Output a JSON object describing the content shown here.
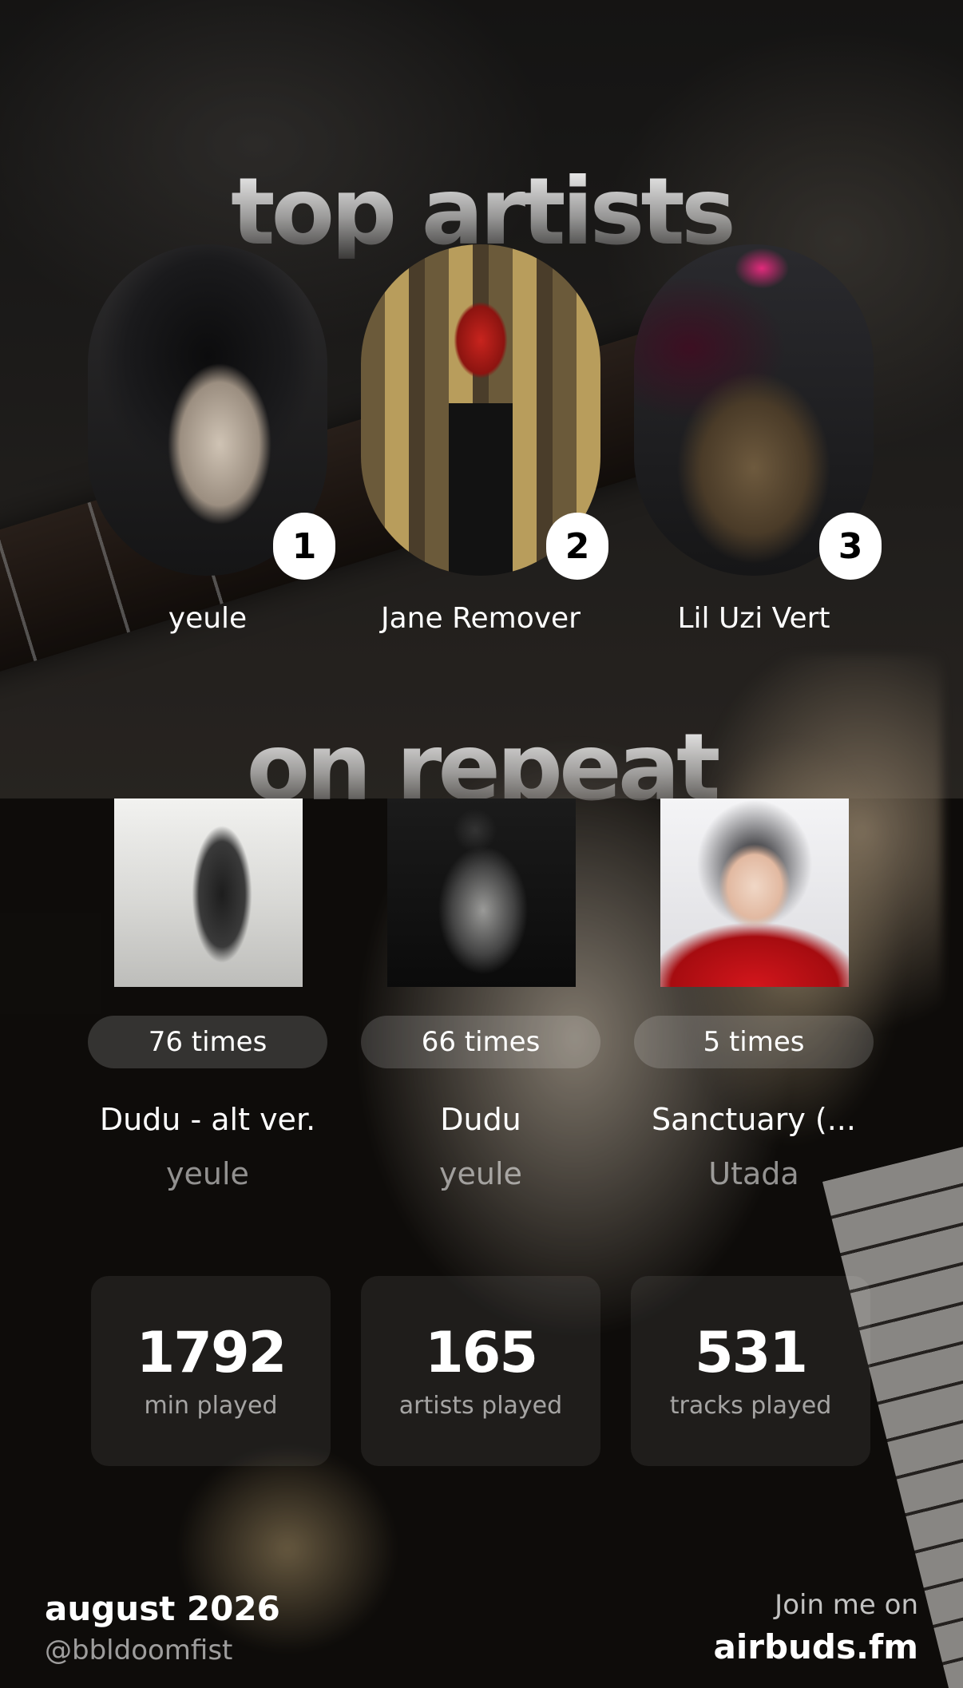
{
  "sections": {
    "top_artists_title": "top artists",
    "on_repeat_title": "on repeat"
  },
  "top_artists": [
    {
      "rank": "1",
      "name": "yeule"
    },
    {
      "rank": "2",
      "name": "Jane Remover"
    },
    {
      "rank": "3",
      "name": "Lil Uzi Vert"
    }
  ],
  "on_repeat": [
    {
      "plays": "76 times",
      "title": "Dudu - alt ver.",
      "artist": "yeule"
    },
    {
      "plays": "66 times",
      "title": "Dudu",
      "artist": "yeule"
    },
    {
      "plays": "5 times",
      "title": "Sanctuary (...",
      "artist": "Utada"
    }
  ],
  "stats": [
    {
      "value": "1792",
      "label": "min played"
    },
    {
      "value": "165",
      "label": "artists played"
    },
    {
      "value": "531",
      "label": "tracks played"
    }
  ],
  "footer": {
    "period": "august 2026",
    "handle": "@bbldoomfist",
    "cta": "Join me on",
    "site": "airbuds.fm"
  },
  "colors": {
    "text": "#ffffff",
    "rank_badge_bg": "#ffffff",
    "rank_badge_text": "#000000"
  }
}
